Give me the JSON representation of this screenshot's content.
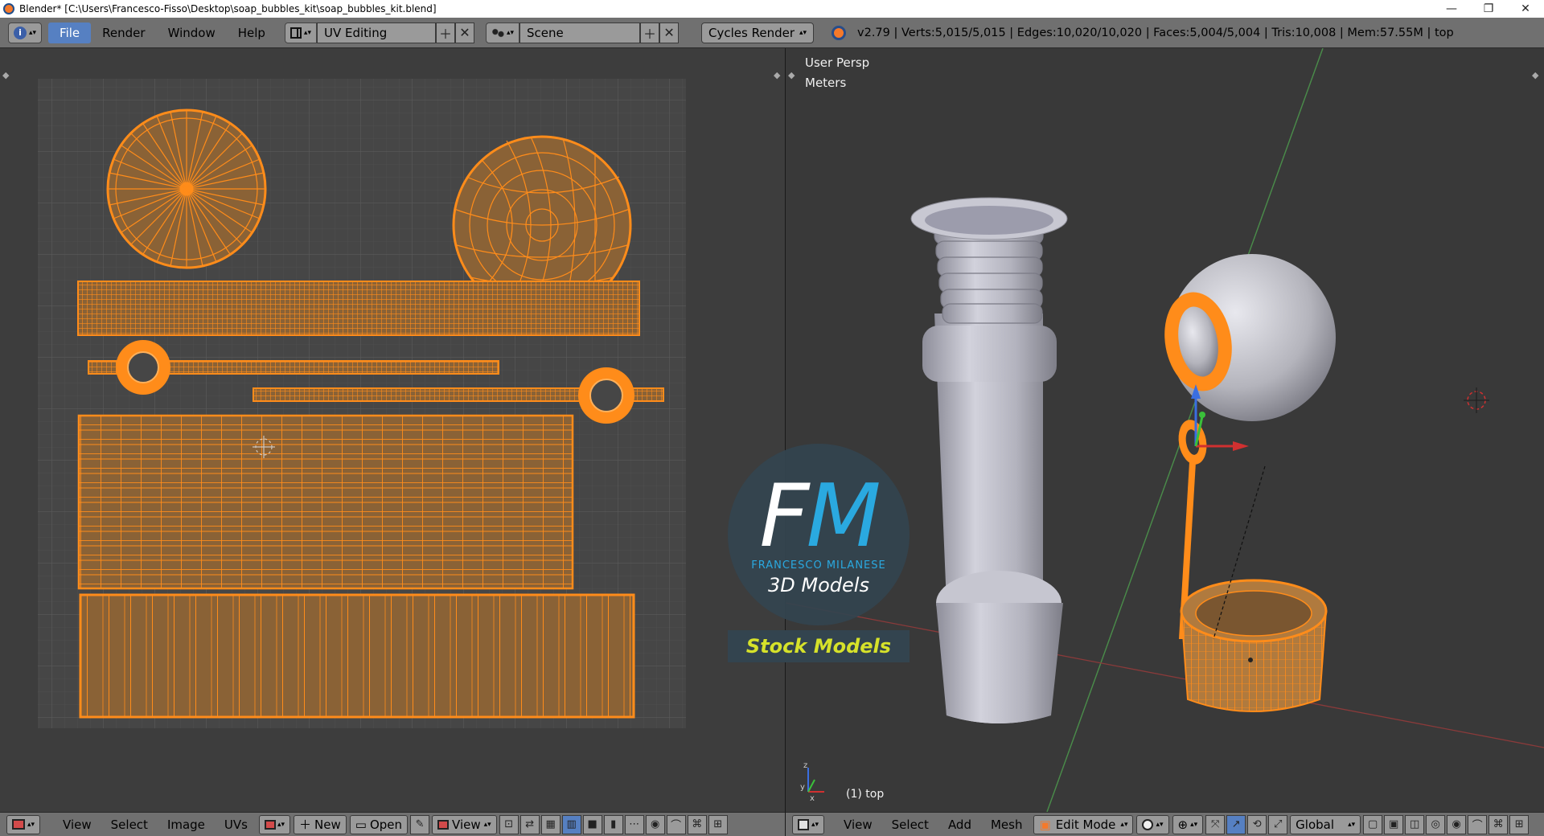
{
  "window": {
    "title": "Blender* [C:\\Users\\Francesco-Fisso\\Desktop\\soap_bubbles_kit\\soap_bubbles_kit.blend]",
    "controls": [
      "—",
      "❐",
      "✕"
    ]
  },
  "info_header": {
    "menus": [
      "File",
      "Render",
      "Window",
      "Help"
    ],
    "active_menu": "File",
    "screen_layout": "UV Editing",
    "scene": "Scene",
    "render_engine": "Cycles Render",
    "stats": "v2.79 | Verts:5,015/5,015 | Edges:10,020/10,020 | Faces:5,004/5,004 | Tris:10,008 | Mem:57.55M | top"
  },
  "uv_editor_footer": {
    "menus": [
      "View",
      "Select",
      "Image",
      "UVs"
    ],
    "new_label": "New",
    "open_label": "Open",
    "view_label": "View"
  },
  "viewport": {
    "perspective_label": "User Persp",
    "units_label": "Meters",
    "object_label": "(1) top"
  },
  "viewport_footer": {
    "menus": [
      "View",
      "Select",
      "Add",
      "Mesh"
    ],
    "mode": "Edit Mode",
    "orientation": "Global"
  },
  "watermark": {
    "letters_f": "F",
    "letters_m": "M",
    "name": "FRANCESCO MILANESE",
    "tagline": "3D Models",
    "banner": "Stock Models"
  }
}
